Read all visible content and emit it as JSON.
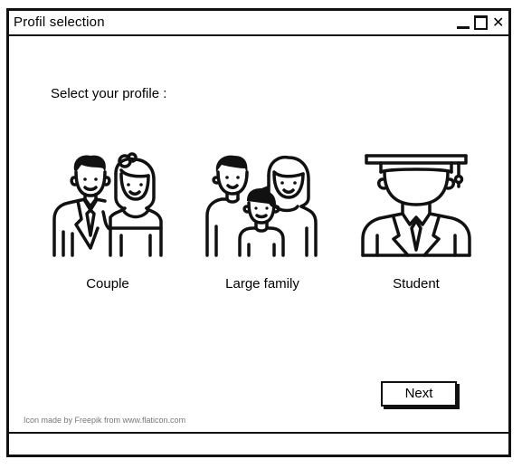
{
  "window": {
    "title": "Profil selection"
  },
  "controls": {
    "minimize": "minimize-icon",
    "maximize": "maximize-icon",
    "close": "close-icon"
  },
  "main": {
    "prompt": "Select your profile :",
    "profiles": [
      {
        "label": "Couple",
        "icon": "couple-icon"
      },
      {
        "label": "Large family",
        "icon": "large-family-icon"
      },
      {
        "label": "Student",
        "icon": "student-icon"
      }
    ],
    "next_label": "Next",
    "credit": "Icon made by Freepik from www.flaticon.com"
  },
  "colors": {
    "stroke": "#111111",
    "background": "#ffffff",
    "credit_text": "#777777"
  }
}
